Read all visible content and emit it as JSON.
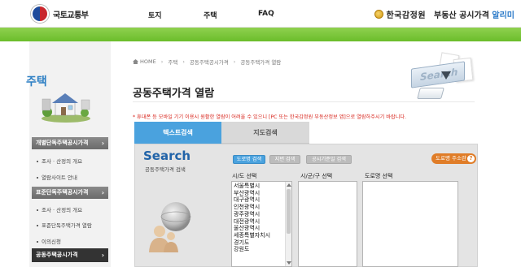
{
  "header": {
    "ministry_name": "국토교통부",
    "nav": [
      "토지",
      "주택",
      "FAQ"
    ],
    "brand_name": "한국감정원",
    "service_name_prefix": "부동산 공시가격",
    "service_name_suffix": "알리미"
  },
  "sidebar": {
    "title": "주택",
    "menu": [
      {
        "label": "개별단독주택공시가격",
        "type": "section"
      },
      {
        "label": "조사 · 산정의 개요",
        "type": "item"
      },
      {
        "label": "열람사이트 안내",
        "type": "item"
      },
      {
        "label": "표준단독주택공시가격",
        "type": "section"
      },
      {
        "label": "조사 · 산정의 개요",
        "type": "item"
      },
      {
        "label": "표준단독주택가격 열람",
        "type": "item"
      },
      {
        "label": "이의신청",
        "type": "item"
      },
      {
        "label": "공동주택공시가격",
        "type": "section-active"
      }
    ]
  },
  "breadcrumb": [
    "HOME",
    "주택",
    "공동주택공시가격",
    "공동주택가격 열람"
  ],
  "page": {
    "title": "공동주택가격 열람",
    "notice": "* 휴대폰 등 모바일 기기 이용시 원활한 열람이 어려울 수 있으니 [PC 또는 한국감정원 부동산정보 앱]으로 열람하주시기 바랍니다."
  },
  "hero": {
    "search_text": "Search"
  },
  "tabs": [
    {
      "label": "텍스트검색",
      "active": true
    },
    {
      "label": "지도검색",
      "active": false
    }
  ],
  "search_panel": {
    "heading": "Search",
    "subheading": "공동주택가격 검색",
    "mode_buttons": [
      "도로명 검색",
      "지번 검색",
      "공시기준일 검색"
    ],
    "address_search_button": "도로명 주소란",
    "columns": [
      "시/도 선택",
      "시/군/구 선택",
      "도로명 선택"
    ],
    "sido_options": [
      "서울특별시",
      "부산광역시",
      "대구광역시",
      "인천광역시",
      "광주광역시",
      "대전광역시",
      "울산광역시",
      "세종특별자치시",
      "경기도",
      "강원도"
    ]
  },
  "colors": {
    "accent_blue": "#4aa2de",
    "green_bar": "#7cc63b",
    "notice_red": "#d8261d",
    "orange_button": "#e07d28"
  }
}
